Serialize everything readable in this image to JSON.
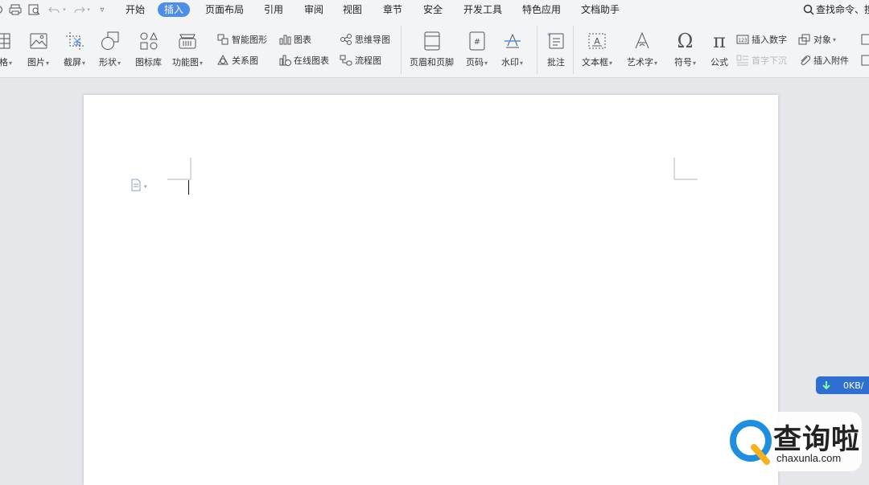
{
  "menubar": {
    "items": [
      "开始",
      "插入",
      "页面布局",
      "引用",
      "审阅",
      "视图",
      "章节",
      "安全",
      "开发工具",
      "特色应用",
      "文档助手"
    ],
    "active_index": 1,
    "search_label": "查找命令、搜"
  },
  "ribbon": {
    "table": "表格",
    "picture": "图片",
    "screenshot": "截屏",
    "shape": "形状",
    "icon_lib": "图标库",
    "func_chart": "功能图",
    "smart_shape": "智能图形",
    "relation": "关系图",
    "chart": "图表",
    "online_chart": "在线图表",
    "mindmap": "思维导图",
    "flowchart": "流程图",
    "header_footer": "页眉和页脚",
    "page_num": "页码",
    "watermark": "水印",
    "comment": "批注",
    "textbox": "文本框",
    "wordart": "艺术字",
    "symbol": "符号",
    "formula": "公式",
    "insert_number": "插入数字",
    "drop_cap": "首字下沉",
    "object": "对象",
    "attachment": "插入附件"
  },
  "speed": "0KB/",
  "logo": {
    "main": "查询啦",
    "sub": "chaxunla.com"
  }
}
